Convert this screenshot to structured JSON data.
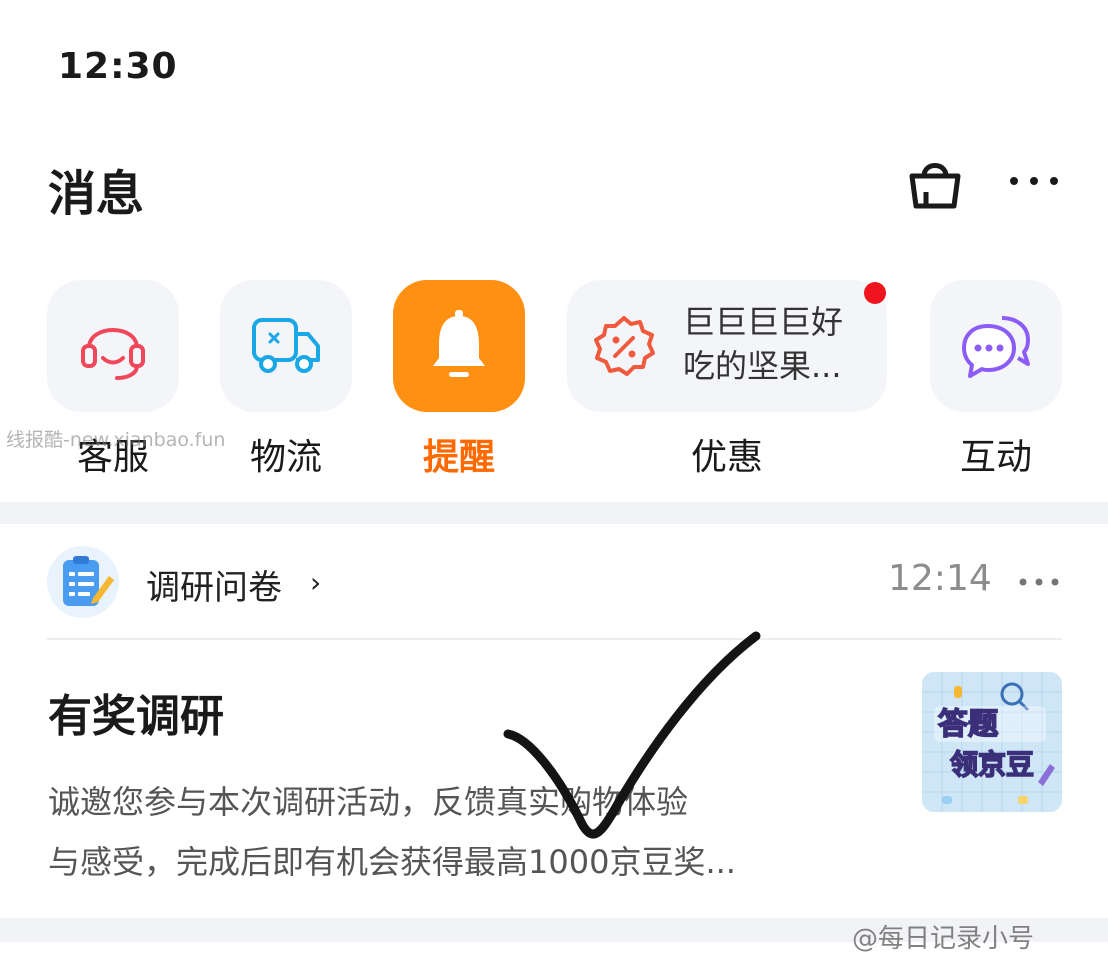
{
  "status_bar": {
    "time": "12:30"
  },
  "header": {
    "title": "消息",
    "cart_icon": "shopping-bag-icon",
    "more_icon": "more-horizontal-icon"
  },
  "categories": [
    {
      "label": "客服",
      "icon": "headset-icon",
      "color": "#f0485a"
    },
    {
      "label": "物流",
      "icon": "delivery-truck-icon",
      "color": "#1aa7e6"
    },
    {
      "label": "提醒",
      "icon": "bell-icon",
      "color": "#ff9011",
      "active": true
    },
    {
      "label": "优惠",
      "icon": "discount-badge-icon",
      "color": "#f05a3c",
      "preview_line1": "巨巨巨巨好",
      "preview_line2": "吃的坚果...",
      "has_unread_dot": true
    },
    {
      "label": "互动",
      "icon": "chat-bubbles-icon",
      "color": "#8b5cf6"
    }
  ],
  "watermarks": {
    "left": "线报酷-new.xianbao.fun",
    "right": "@每日记录小号"
  },
  "message": {
    "source": "调研问卷",
    "source_chevron": "›",
    "time": "12:14",
    "title": "有奖调研",
    "body_line1": "诚邀您参与本次调研活动，反馈真实购物体验",
    "body_line2": "与感受，完成后即有机会获得最高1000京豆奖...",
    "thumbnail_text_top": "答题",
    "thumbnail_text_bottom": "领京豆"
  },
  "colors": {
    "accent_orange": "#ff9011",
    "active_label": "#ff6a00",
    "unread_dot": "#f0141e",
    "time_gray": "#8c8c8c"
  }
}
